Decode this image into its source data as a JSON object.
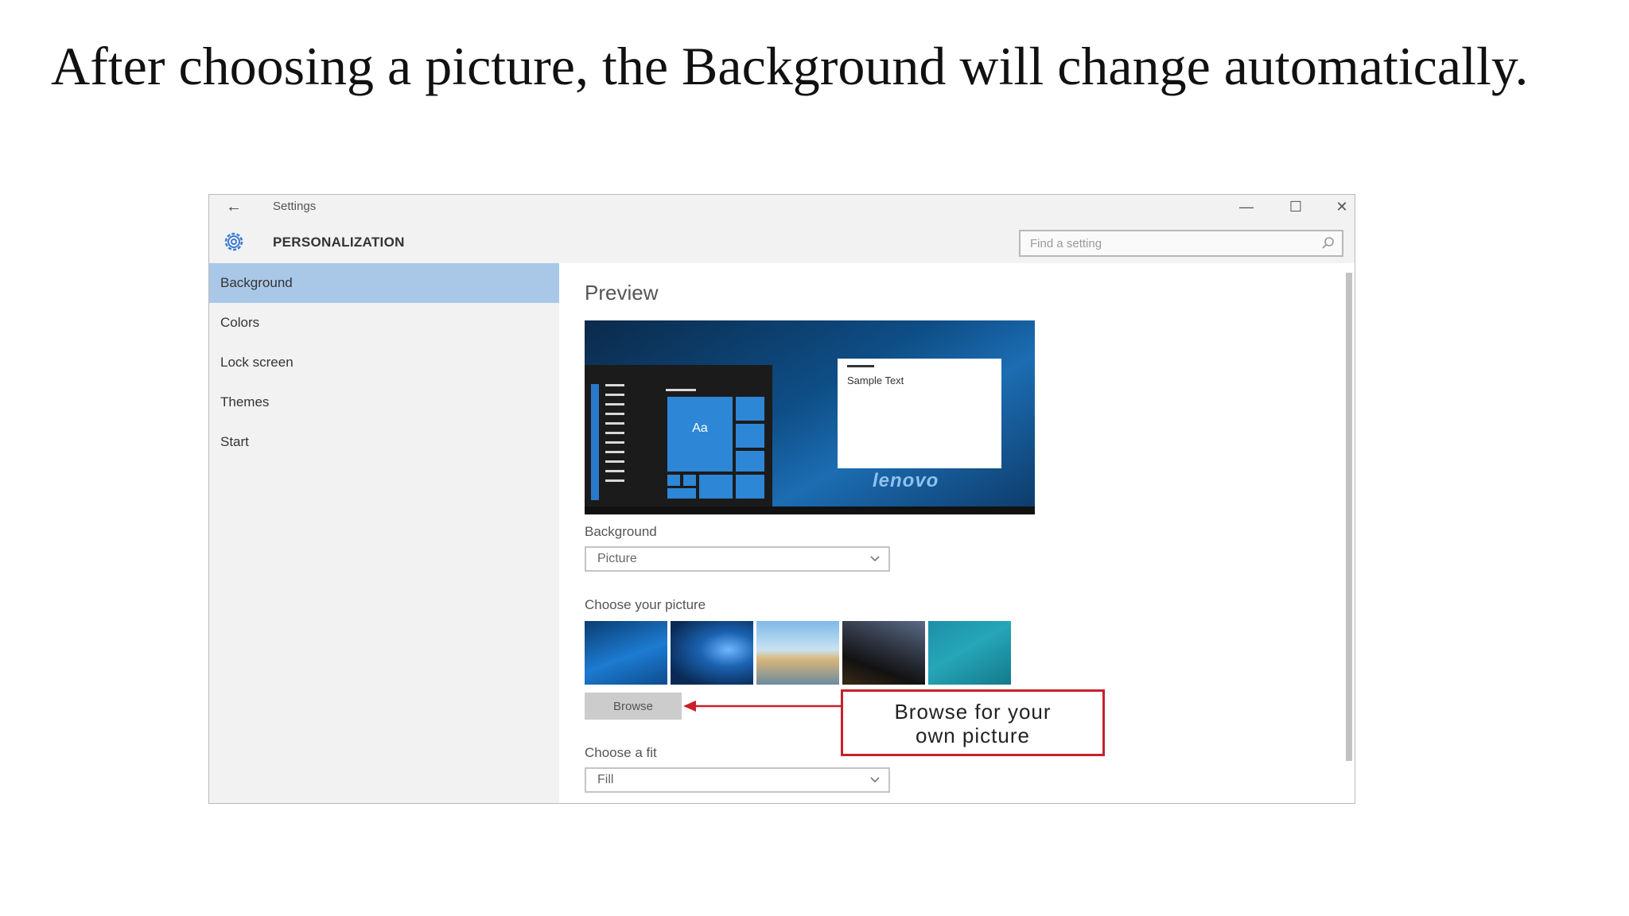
{
  "caption": "After choosing a picture, the Background will change automatically.",
  "window": {
    "title": "Settings",
    "minimize_glyph": "—",
    "maximize_glyph": "☐",
    "close_glyph": "✕",
    "back_glyph": "←"
  },
  "header": {
    "section_title": "PERSONALIZATION",
    "search_placeholder": "Find a setting"
  },
  "sidebar": {
    "items": [
      {
        "label": "Background",
        "active": true
      },
      {
        "label": "Colors",
        "active": false
      },
      {
        "label": "Lock screen",
        "active": false
      },
      {
        "label": "Themes",
        "active": false
      },
      {
        "label": "Start",
        "active": false
      }
    ]
  },
  "content": {
    "preview_title": "Preview",
    "preview": {
      "tile_text": "Aa",
      "sample_text": "Sample Text",
      "brand_text": "lenovo"
    },
    "background_label": "Background",
    "background_value": "Picture",
    "choose_picture_label": "Choose your picture",
    "browse_label": "Browse",
    "choose_fit_label": "Choose a fit",
    "fit_value": "Fill"
  },
  "annotation": {
    "callout_line1": "Browse for your",
    "callout_line2": "own picture",
    "color": "#c8202c"
  },
  "colors": {
    "accent": "#a9c8e8",
    "window_bg": "#f2f2f2",
    "content_bg": "#ffffff"
  }
}
